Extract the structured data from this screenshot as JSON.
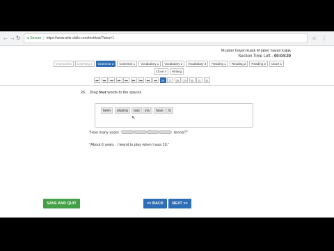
{
  "browser": {
    "secure_label": "Secure",
    "url": "https://www.ielts-skills.com/test/test/?idea=1",
    "nav_icons": [
      "back-icon",
      "forward-icon",
      "reload-icon"
    ]
  },
  "header": {
    "user_line": "M jaber hayan kujak M jaber hayan kujak",
    "timer_label": "Section Time Left -",
    "timer_value": "00:04:20"
  },
  "tabs": [
    {
      "label": "Instructions",
      "state": "faded"
    },
    {
      "label": "Listening 1",
      "state": "faded"
    },
    {
      "label": "Grammar 2",
      "state": "active"
    },
    {
      "label": "Grammar 1",
      "state": "normal"
    },
    {
      "label": "Vocabulary 1",
      "state": "normal"
    },
    {
      "label": "Vocabulary 2",
      "state": "normal"
    },
    {
      "label": "Vocabulary 3",
      "state": "normal"
    },
    {
      "label": "Reading 1",
      "state": "normal"
    },
    {
      "label": "Reading 2",
      "state": "normal"
    },
    {
      "label": "Reading 3",
      "state": "normal"
    },
    {
      "label": "Cloze 1",
      "state": "normal"
    },
    {
      "label": "Cloze 4",
      "state": "normal"
    },
    {
      "label": "Writing",
      "state": "normal"
    }
  ],
  "question_nav": [
    {
      "label": "17",
      "state": "done"
    },
    {
      "label": "18",
      "state": "done"
    },
    {
      "label": "19",
      "state": "done"
    },
    {
      "label": "20",
      "state": "done"
    },
    {
      "label": "21",
      "state": "done"
    },
    {
      "label": "22",
      "state": "done"
    },
    {
      "label": "23",
      "state": "done"
    },
    {
      "label": "24",
      "state": "done"
    },
    {
      "label": "25",
      "state": "done"
    },
    {
      "label": "26",
      "state": "current"
    },
    {
      "label": "27",
      "state": "normal"
    },
    {
      "label": "28",
      "state": "normal"
    },
    {
      "label": "29",
      "state": "normal"
    },
    {
      "label": "30",
      "state": "normal"
    },
    {
      "label": "31",
      "state": "normal"
    },
    {
      "label": "32",
      "state": "normal"
    }
  ],
  "question": {
    "number": "26.",
    "text_before": "Drag ",
    "text_bold": "four",
    "text_after": " words to the spaces"
  },
  "words": [
    "been",
    "playing",
    "was",
    "you",
    "have",
    "to"
  ],
  "sentence1": {
    "before": "\"How many years",
    "blank_count": 4,
    "after": "tennis?\""
  },
  "sentence2": "\"About 6 years . I learnt to play when I was 10.\"",
  "buttons": {
    "save": "SAVE AND QUIT",
    "back": "<< BACK",
    "next": "NEXT >>"
  },
  "colors": {
    "accent": "#2d6db5",
    "save": "#43a047"
  }
}
